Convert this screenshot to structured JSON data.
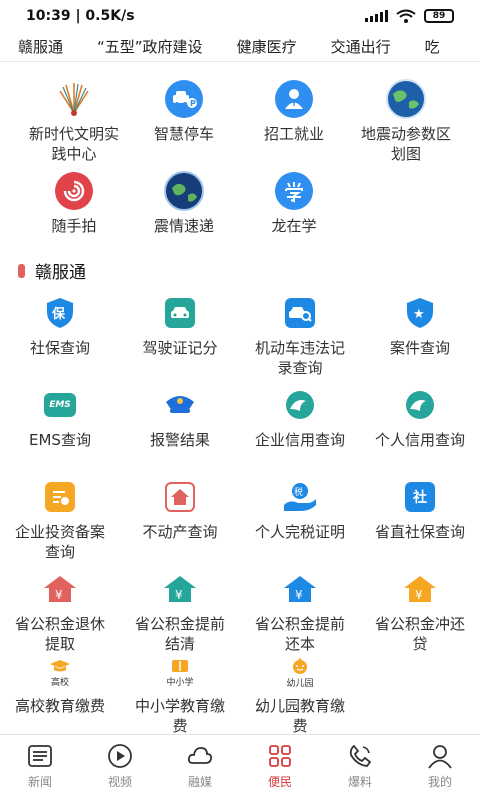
{
  "status": {
    "time": "10:39 | 0.5K/s",
    "battery": "89"
  },
  "categories": [
    "赣服通",
    "“五型”政府建设",
    "健康医疗",
    "交通出行",
    "吃"
  ],
  "top_services": [
    {
      "label": "新时代文明实践中心",
      "icon": "civilization-center-icon"
    },
    {
      "label": "智慧停车",
      "icon": "parking-car-icon"
    },
    {
      "label": "招工就业",
      "icon": "recruitment-person-icon"
    },
    {
      "label": "地震动参数区划图",
      "icon": "earth-globe-icon"
    },
    {
      "label": "随手拍",
      "icon": "snapshot-swirl-icon"
    },
    {
      "label": "震情速递",
      "icon": "earth-globe-icon"
    },
    {
      "label": "龙在学",
      "icon": "study-character-icon"
    }
  ],
  "section": {
    "title": "赣服通"
  },
  "gan_services": [
    {
      "label": "社保查询",
      "icon_text": "保",
      "color": "#1e88e5"
    },
    {
      "label": "驾驶证记分",
      "icon_text": "",
      "color": "#26a69a"
    },
    {
      "label": "机动车违法记录查询",
      "icon_text": "",
      "color": "#1e88e5"
    },
    {
      "label": "案件查询",
      "icon_text": "★",
      "color": "#1e88e5"
    },
    {
      "label": "EMS查询",
      "icon_text": "EMS",
      "color": "#26a69a"
    },
    {
      "label": "报警结果",
      "icon_text": "",
      "color": "#1e6fd9"
    },
    {
      "label": "企业信用查询",
      "icon_text": "",
      "color": "#26a69a"
    },
    {
      "label": "个人信用查询",
      "icon_text": "",
      "color": "#26a69a"
    },
    {
      "label": "企业投资备案查询",
      "icon_text": "",
      "color": "#f5a623"
    },
    {
      "label": "不动产查询",
      "icon_text": "",
      "color": "#e0615d"
    },
    {
      "label": "个人完税证明",
      "icon_text": "税",
      "color": "#1e88e5"
    },
    {
      "label": "省直社保查询",
      "icon_text": "社",
      "color": "#1e88e5"
    },
    {
      "label": "省公积金退休提取",
      "icon_text": "¥",
      "color": "#e0615d"
    },
    {
      "label": "省公积金提前结清",
      "icon_text": "¥",
      "color": "#26a69a"
    },
    {
      "label": "省公积金提前还本",
      "icon_text": "¥",
      "color": "#1e88e5"
    },
    {
      "label": "省公积金冲还贷",
      "icon_text": "¥",
      "color": "#f5a623"
    },
    {
      "label": "高校教育缴费",
      "icon_text": "高校",
      "color": "#f5a623"
    },
    {
      "label": "中小学教育缴费",
      "icon_text": "中小学",
      "color": "#f5a623"
    },
    {
      "label": "幼儿园教育缴费",
      "icon_text": "幼儿园",
      "color": "#f5a623"
    }
  ],
  "nav": [
    {
      "label": "新闻",
      "icon": "news-list-icon"
    },
    {
      "label": "视频",
      "icon": "video-play-icon"
    },
    {
      "label": "融媒",
      "icon": "cloud-icon"
    },
    {
      "label": "便民",
      "icon": "grid-apps-icon",
      "active": true
    },
    {
      "label": "爆料",
      "icon": "phone-icon"
    },
    {
      "label": "我的",
      "icon": "user-profile-icon"
    }
  ],
  "accent": "#d43a3a"
}
